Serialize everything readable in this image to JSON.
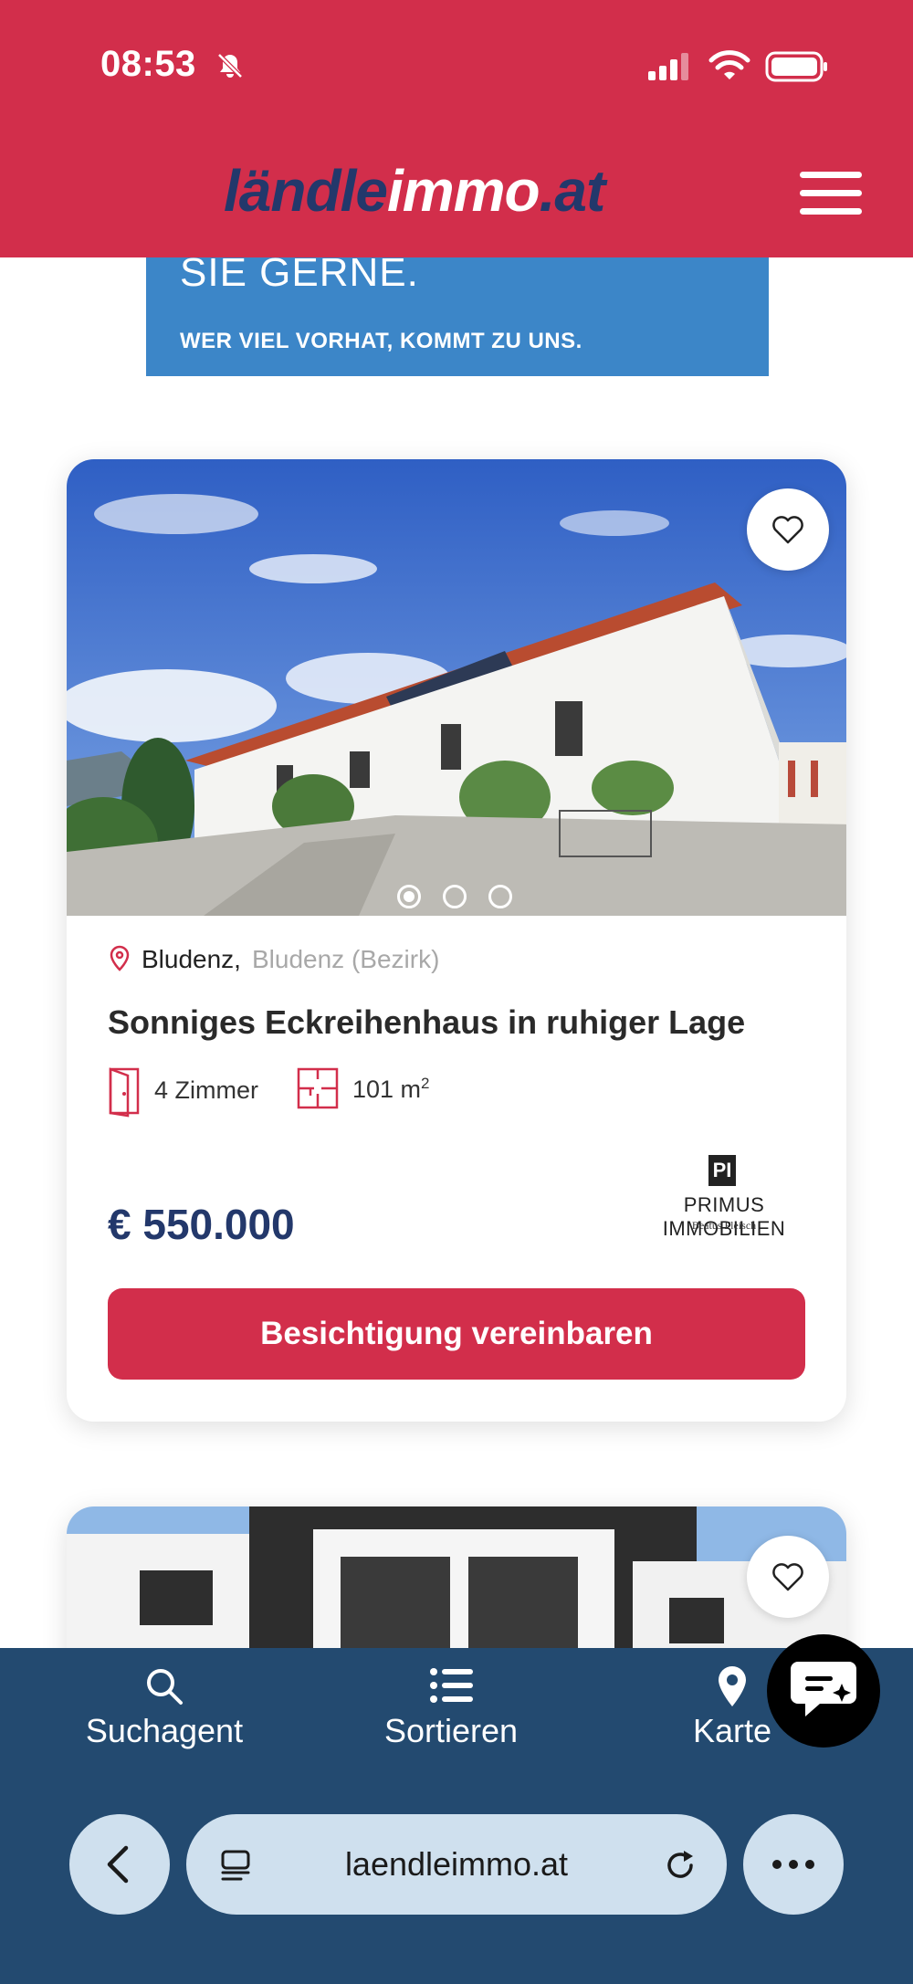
{
  "status_bar": {
    "time": "08:53"
  },
  "header": {
    "logo_part1": "ländle",
    "logo_part2": "immo",
    "logo_part3": ".at"
  },
  "banner": {
    "headline_fragment": "SIE GERNE.",
    "tagline": "WER VIEL VORHAT, KOMMT ZU UNS."
  },
  "listing": {
    "city": "Bludenz,",
    "district": "Bludenz (Bezirk)",
    "title": "Sonniges Eckreihenhaus in ruhiger Lage",
    "rooms": "4 Zimmer",
    "area": "101 m",
    "area_unit_sup": "2",
    "price": "€ 550.000",
    "agent_mark": "PI",
    "agent_name": "PRIMUS IMMOBILIEN",
    "agent_sub": "Beatus Fleisch",
    "cta_label": "Besichtigung vereinbaren",
    "carousel_total": 3,
    "carousel_active": 1
  },
  "bottom_nav": {
    "items": [
      {
        "label": "Suchagent",
        "icon": "search-icon"
      },
      {
        "label": "Sortieren",
        "icon": "list-icon"
      },
      {
        "label": "Karte",
        "icon": "map-pin-icon"
      }
    ]
  },
  "browser": {
    "url": "laendleimmo.at"
  },
  "colors": {
    "brand_red": "#d22e4b",
    "brand_navy": "#23386b",
    "nav_blue": "#234a70",
    "banner_blue": "#3c86c8"
  }
}
